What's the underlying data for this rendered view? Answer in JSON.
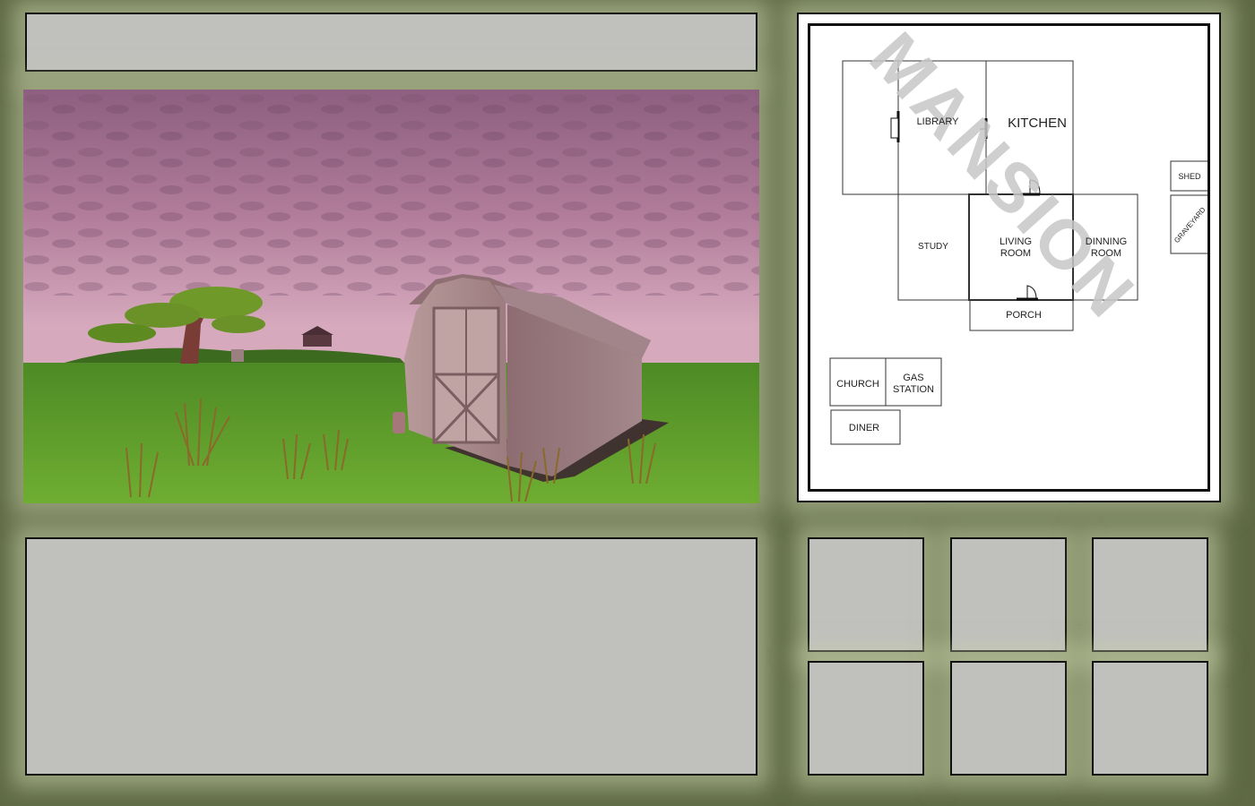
{
  "title_bar": {
    "text": ""
  },
  "text_box": {
    "text": ""
  },
  "scene": {
    "description_icon": "shed-scene-image"
  },
  "map": {
    "watermark": "MANSION",
    "rooms": {
      "library": "LIBRARY",
      "kitchen": "KITCHEN",
      "study": "STUDY",
      "living_room": [
        "LIVING",
        "ROOM"
      ],
      "dinning_room": [
        "DINNING",
        "ROOM"
      ],
      "porch": "PORCH",
      "shed": "SHED",
      "graveyard": "GRAVEYARD",
      "church": "CHURCH",
      "gas_station": [
        "GAS",
        "STATION"
      ],
      "diner": "DINER"
    }
  },
  "inventory": {
    "slots": [
      "",
      "",
      "",
      "",
      "",
      ""
    ]
  },
  "colors": {
    "background": "#5f6a45",
    "panel": "#c0c1bd",
    "sky": "#b98aa6",
    "grass": "#5f9a2a"
  }
}
